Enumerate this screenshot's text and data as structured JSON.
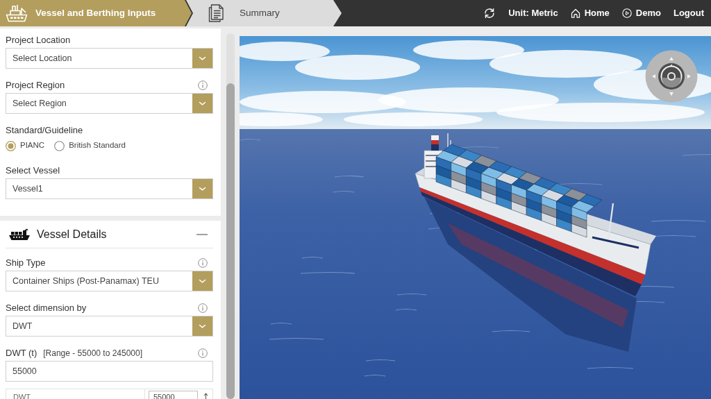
{
  "header": {
    "steps": [
      {
        "kind": "vessel",
        "label": "Vessel and Berthing Inputs",
        "selected": true
      },
      {
        "kind": "document",
        "label": "Summary",
        "selected": false
      }
    ],
    "links": [
      {
        "kind": "unit",
        "label": "Unit: Metric"
      },
      {
        "kind": "home",
        "label": "Home"
      },
      {
        "kind": "demo",
        "label": "Demo"
      },
      {
        "kind": "logout",
        "label": "Logout"
      }
    ]
  },
  "project": {
    "fields": [
      {
        "kind": "select",
        "label": "Project Location",
        "info": false,
        "value": "Select Location"
      },
      {
        "kind": "select",
        "label": "Project Region",
        "info": true,
        "value": "Select Region"
      },
      {
        "kind": "radio",
        "label": "Standard/Guideline",
        "options": [
          {
            "label": "PIANC",
            "selected": true
          },
          {
            "label": "British Standard",
            "selected": false
          }
        ]
      },
      {
        "kind": "select",
        "label": "Select Vessel",
        "info": false,
        "value": "Vessel1"
      }
    ]
  },
  "vessel_details": {
    "title": "Vessel Details",
    "expanded": true,
    "fields": [
      {
        "kind": "select",
        "label": "Ship Type",
        "info": true,
        "value": "Container Ships (Post-Panamax) TEU"
      },
      {
        "kind": "select",
        "label": "Select dimension by",
        "info": true,
        "value": "DWT"
      },
      {
        "kind": "text",
        "label": "DWT (t)",
        "note": "[Range - 55000 to 245000]",
        "info": true,
        "value": "55000"
      },
      {
        "kind": "row",
        "label": "DWT",
        "value": "55000"
      }
    ]
  }
}
